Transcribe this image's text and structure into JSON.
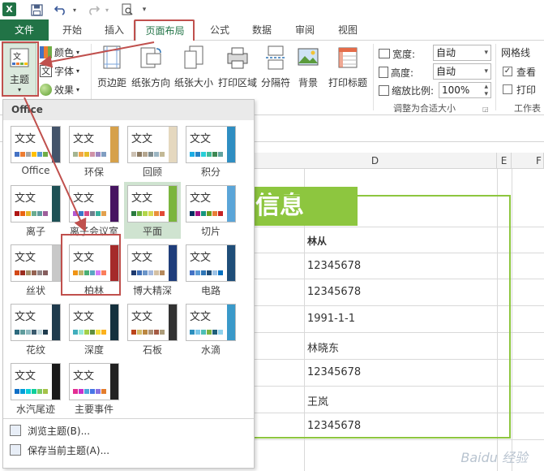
{
  "quick_access": {
    "app_icon": "X"
  },
  "tabs": [
    {
      "id": "file",
      "label": "文件"
    },
    {
      "id": "home",
      "label": "开始"
    },
    {
      "id": "insert",
      "label": "插入"
    },
    {
      "id": "pagelayout",
      "label": "页面布局"
    },
    {
      "id": "formulas",
      "label": "公式"
    },
    {
      "id": "data",
      "label": "数据"
    },
    {
      "id": "review",
      "label": "审阅"
    },
    {
      "id": "view",
      "label": "视图"
    }
  ],
  "ribbon": {
    "themes": {
      "label": "主题",
      "colors": "颜色",
      "fonts": "字体",
      "effects": "效果"
    },
    "page_setup": {
      "margins": "页边距",
      "orientation": "纸张方向",
      "size": "纸张大小",
      "print_area": "打印区域",
      "breaks": "分隔符",
      "background": "背景",
      "print_titles": "打印标题"
    },
    "scale": {
      "width_label": "宽度:",
      "width_value": "自动",
      "height_label": "高度:",
      "height_value": "自动",
      "scale_label": "缩放比例:",
      "scale_value": "100%",
      "group_label": "调整为合适大小"
    },
    "sheet_options": {
      "gridlines_label": "网格线",
      "view_label": "查看",
      "print_label": "打印",
      "group_label": "工作表"
    }
  },
  "gallery": {
    "header": "Office",
    "themes": [
      {
        "name": "Office",
        "colors": [
          "#4472c4",
          "#ed7d31",
          "#a5a5a5",
          "#ffc000",
          "#5b9bd5",
          "#70ad47"
        ],
        "stripe": "#44546a"
      },
      {
        "name": "环保",
        "colors": [
          "#a5b592",
          "#f3a447",
          "#e7bc29",
          "#d092a7",
          "#9c85c0",
          "#809ec2"
        ],
        "stripe": "#d6a14b"
      },
      {
        "name": "回顾",
        "colors": [
          "#ccc1b3",
          "#8c7a61",
          "#b5a68f",
          "#7f8c8d",
          "#9bb5c2",
          "#c3b996"
        ],
        "stripe": "#e5d8bf"
      },
      {
        "name": "积分",
        "colors": [
          "#1cade4",
          "#2683c6",
          "#27ced7",
          "#42ba97",
          "#3e8853",
          "#62a39f"
        ],
        "stripe": "#2f8ec2"
      },
      {
        "name": "离子",
        "colors": [
          "#b01513",
          "#ea6312",
          "#e6b729",
          "#6aac90",
          "#5f9c9d",
          "#9e5e9b"
        ],
        "stripe": "#1e5155"
      },
      {
        "name": "离子会议室",
        "colors": [
          "#b258d3",
          "#3a76c9",
          "#d54b8a",
          "#6f7e8c",
          "#38b19d",
          "#e2a14e"
        ],
        "stripe": "#461560"
      },
      {
        "name": "平面",
        "colors": [
          "#2a7b3f",
          "#6fb33f",
          "#b2d64a",
          "#d8d84f",
          "#e98e3a",
          "#e24a36"
        ],
        "stripe": "#7bb53d"
      },
      {
        "name": "切片",
        "colors": [
          "#052f61",
          "#a50e82",
          "#14967c",
          "#6a9e1f",
          "#e87d37",
          "#c62324"
        ],
        "stripe": "#5ba5d8"
      },
      {
        "name": "丝状",
        "colors": [
          "#d34817",
          "#9b2d1f",
          "#a28e6a",
          "#956251",
          "#918485",
          "#855d5d"
        ],
        "stripe": "#c8c8c8"
      },
      {
        "name": "柏林",
        "colors": [
          "#f09415",
          "#c1b56b",
          "#4baf73",
          "#5aa6c0",
          "#d17df9",
          "#fa7e5c"
        ],
        "stripe": "#a52a2a"
      },
      {
        "name": "博大精深",
        "colors": [
          "#1e3a6e",
          "#416fb5",
          "#6b95c9",
          "#a5b9de",
          "#d4c0a3",
          "#b68a5d"
        ],
        "stripe": "#1f3d7a"
      },
      {
        "name": "电路",
        "colors": [
          "#4472c4",
          "#5b9bd5",
          "#2e75b6",
          "#1f4e79",
          "#9dc3e6",
          "#0070c0"
        ],
        "stripe": "#1f4e79"
      },
      {
        "name": "花纹",
        "colors": [
          "#2d6a7e",
          "#5f9c9d",
          "#8fbac0",
          "#3b5b6e",
          "#c1d8de",
          "#1f3b4d"
        ],
        "stripe": "#1f3b4d"
      },
      {
        "name": "深度",
        "colors": [
          "#41aebd",
          "#97e9d5",
          "#a2cf49",
          "#608f3d",
          "#f4de3a",
          "#fcb11c"
        ],
        "stripe": "#14303d"
      },
      {
        "name": "石板",
        "colors": [
          "#bc451b",
          "#d3ba68",
          "#bb8640",
          "#ad9277",
          "#a55a43",
          "#ad9d7b"
        ],
        "stripe": "#323232"
      },
      {
        "name": "水滴",
        "colors": [
          "#2c8fbe",
          "#7ac6e8",
          "#4dbfb6",
          "#7cb342",
          "#1f5f7a",
          "#8fd1ed"
        ],
        "stripe": "#3a99c9"
      },
      {
        "name": "水汽尾迹",
        "colors": [
          "#0f6fc6",
          "#009dd9",
          "#0bd0d9",
          "#10cf9b",
          "#7cca62",
          "#a5c249"
        ],
        "stripe": "#1a1a1a"
      },
      {
        "name": "主要事件",
        "colors": [
          "#e32d91",
          "#c830cc",
          "#4ea6dc",
          "#4775e7",
          "#8971e1",
          "#e37d2d"
        ],
        "stripe": "#222222"
      }
    ],
    "sample_text": "文文",
    "browse": "浏览主题(B)...",
    "save": "保存当前主题(A)..."
  },
  "sheet": {
    "columns": [
      "D",
      "E",
      "F"
    ],
    "title_fragment": "信息",
    "header_cell": "林从",
    "cells": [
      "12345678",
      "12345678",
      "1991-1-1",
      "林晓东",
      "12345678",
      "王岚",
      "12345678"
    ]
  },
  "colors": {
    "excel_green": "#217346",
    "highlight_red": "#c0504d",
    "banner_green": "#8dc63f"
  },
  "watermark": "Baidu 经验"
}
